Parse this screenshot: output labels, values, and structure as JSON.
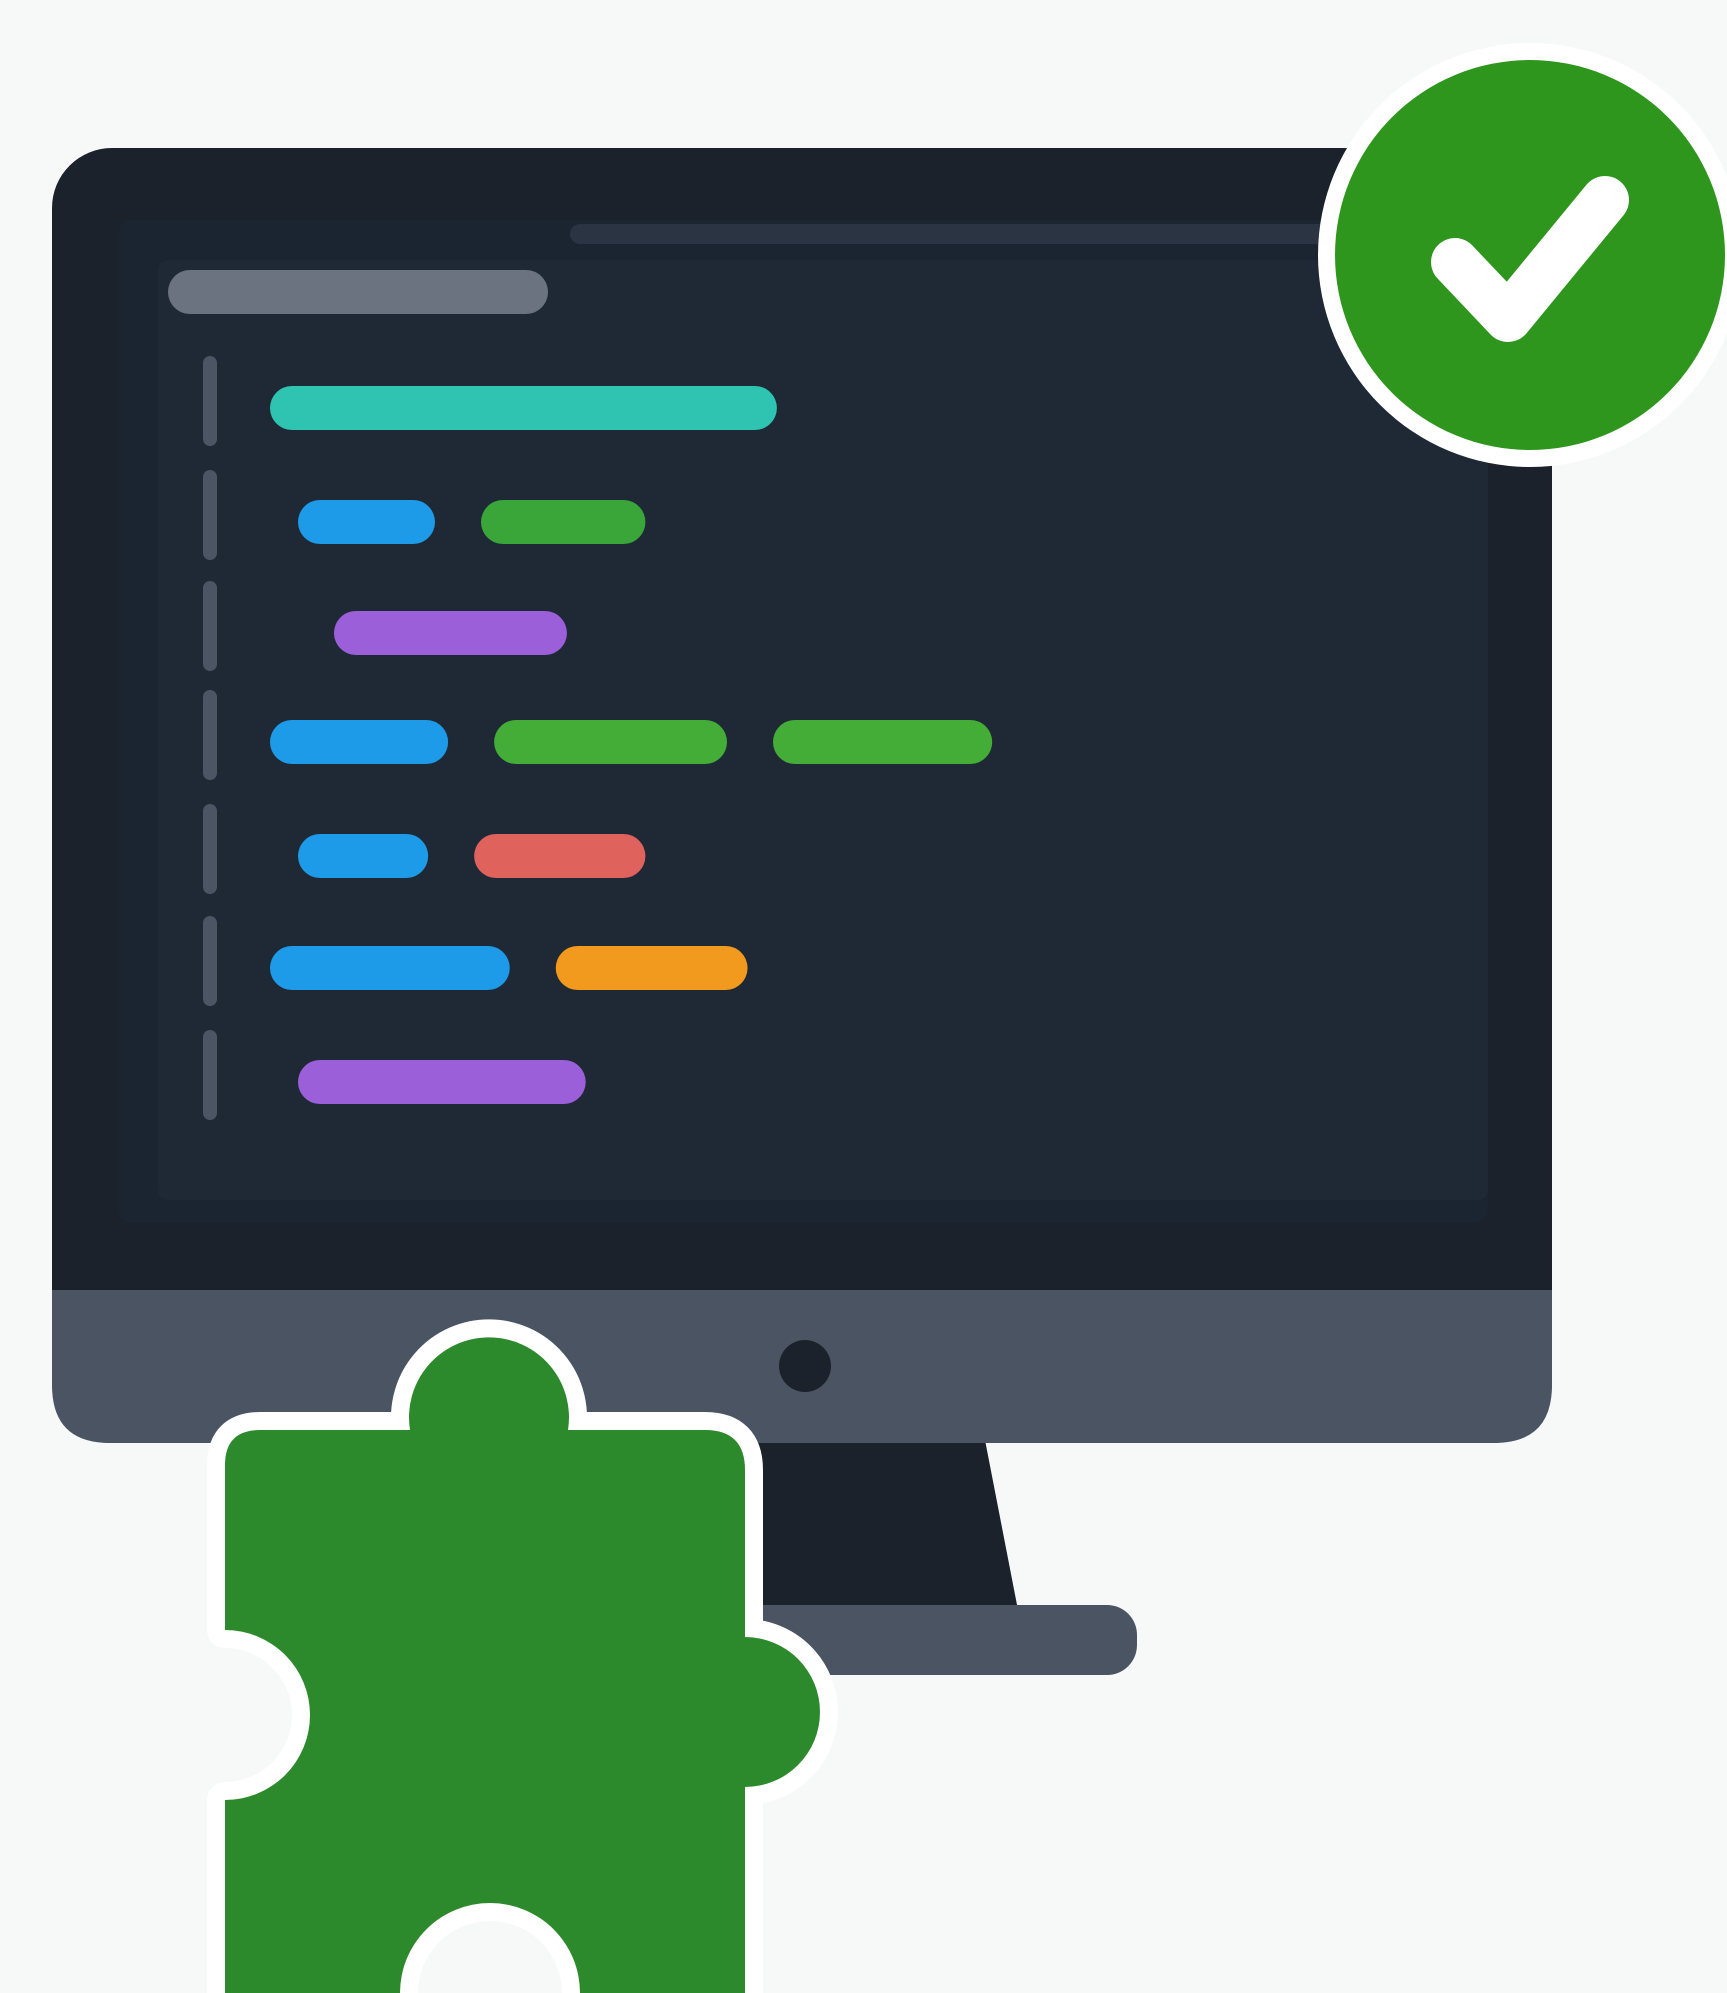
{
  "colors": {
    "background": "#f7f8f8",
    "monitor_bezel": "#1c222b",
    "monitor_chin": "#4a5463",
    "screen": "#1b2431",
    "editor_panel": "#1f2936",
    "gutter_line": "#4b5563",
    "placeholder_bar": "#6b7280",
    "check_badge": "#2e961d",
    "puzzle_piece": "#2d8a2c",
    "outline": "#ffffff"
  },
  "icons": {
    "monitor": "monitor-icon",
    "check": "check-badge-icon",
    "puzzle": "puzzle-piece-icon",
    "camera": "camera-dot-icon"
  },
  "code_lines": [
    [
      {
        "token_color": "#2fc4b2",
        "length": 0.37
      }
    ],
    [
      {
        "token_color": "#1e9be8",
        "length": 0.1
      },
      {
        "token_color": "#3aa63a",
        "length": 0.12
      }
    ],
    [
      {
        "token_color": "#9b5fd9",
        "length": 0.17
      }
    ],
    [
      {
        "token_color": "#1e9be8",
        "length": 0.13
      },
      {
        "token_color": "#44ad38",
        "length": 0.17
      },
      {
        "token_color": "#44ad38",
        "length": 0.16
      }
    ],
    [
      {
        "token_color": "#1e9be8",
        "length": 0.095
      },
      {
        "token_color": "#e0625d",
        "length": 0.125
      }
    ],
    [
      {
        "token_color": "#1e9be8",
        "length": 0.175
      },
      {
        "token_color": "#f29a1d",
        "length": 0.14
      }
    ],
    [
      {
        "token_color": "#9b5fd9",
        "length": 0.21
      }
    ]
  ]
}
